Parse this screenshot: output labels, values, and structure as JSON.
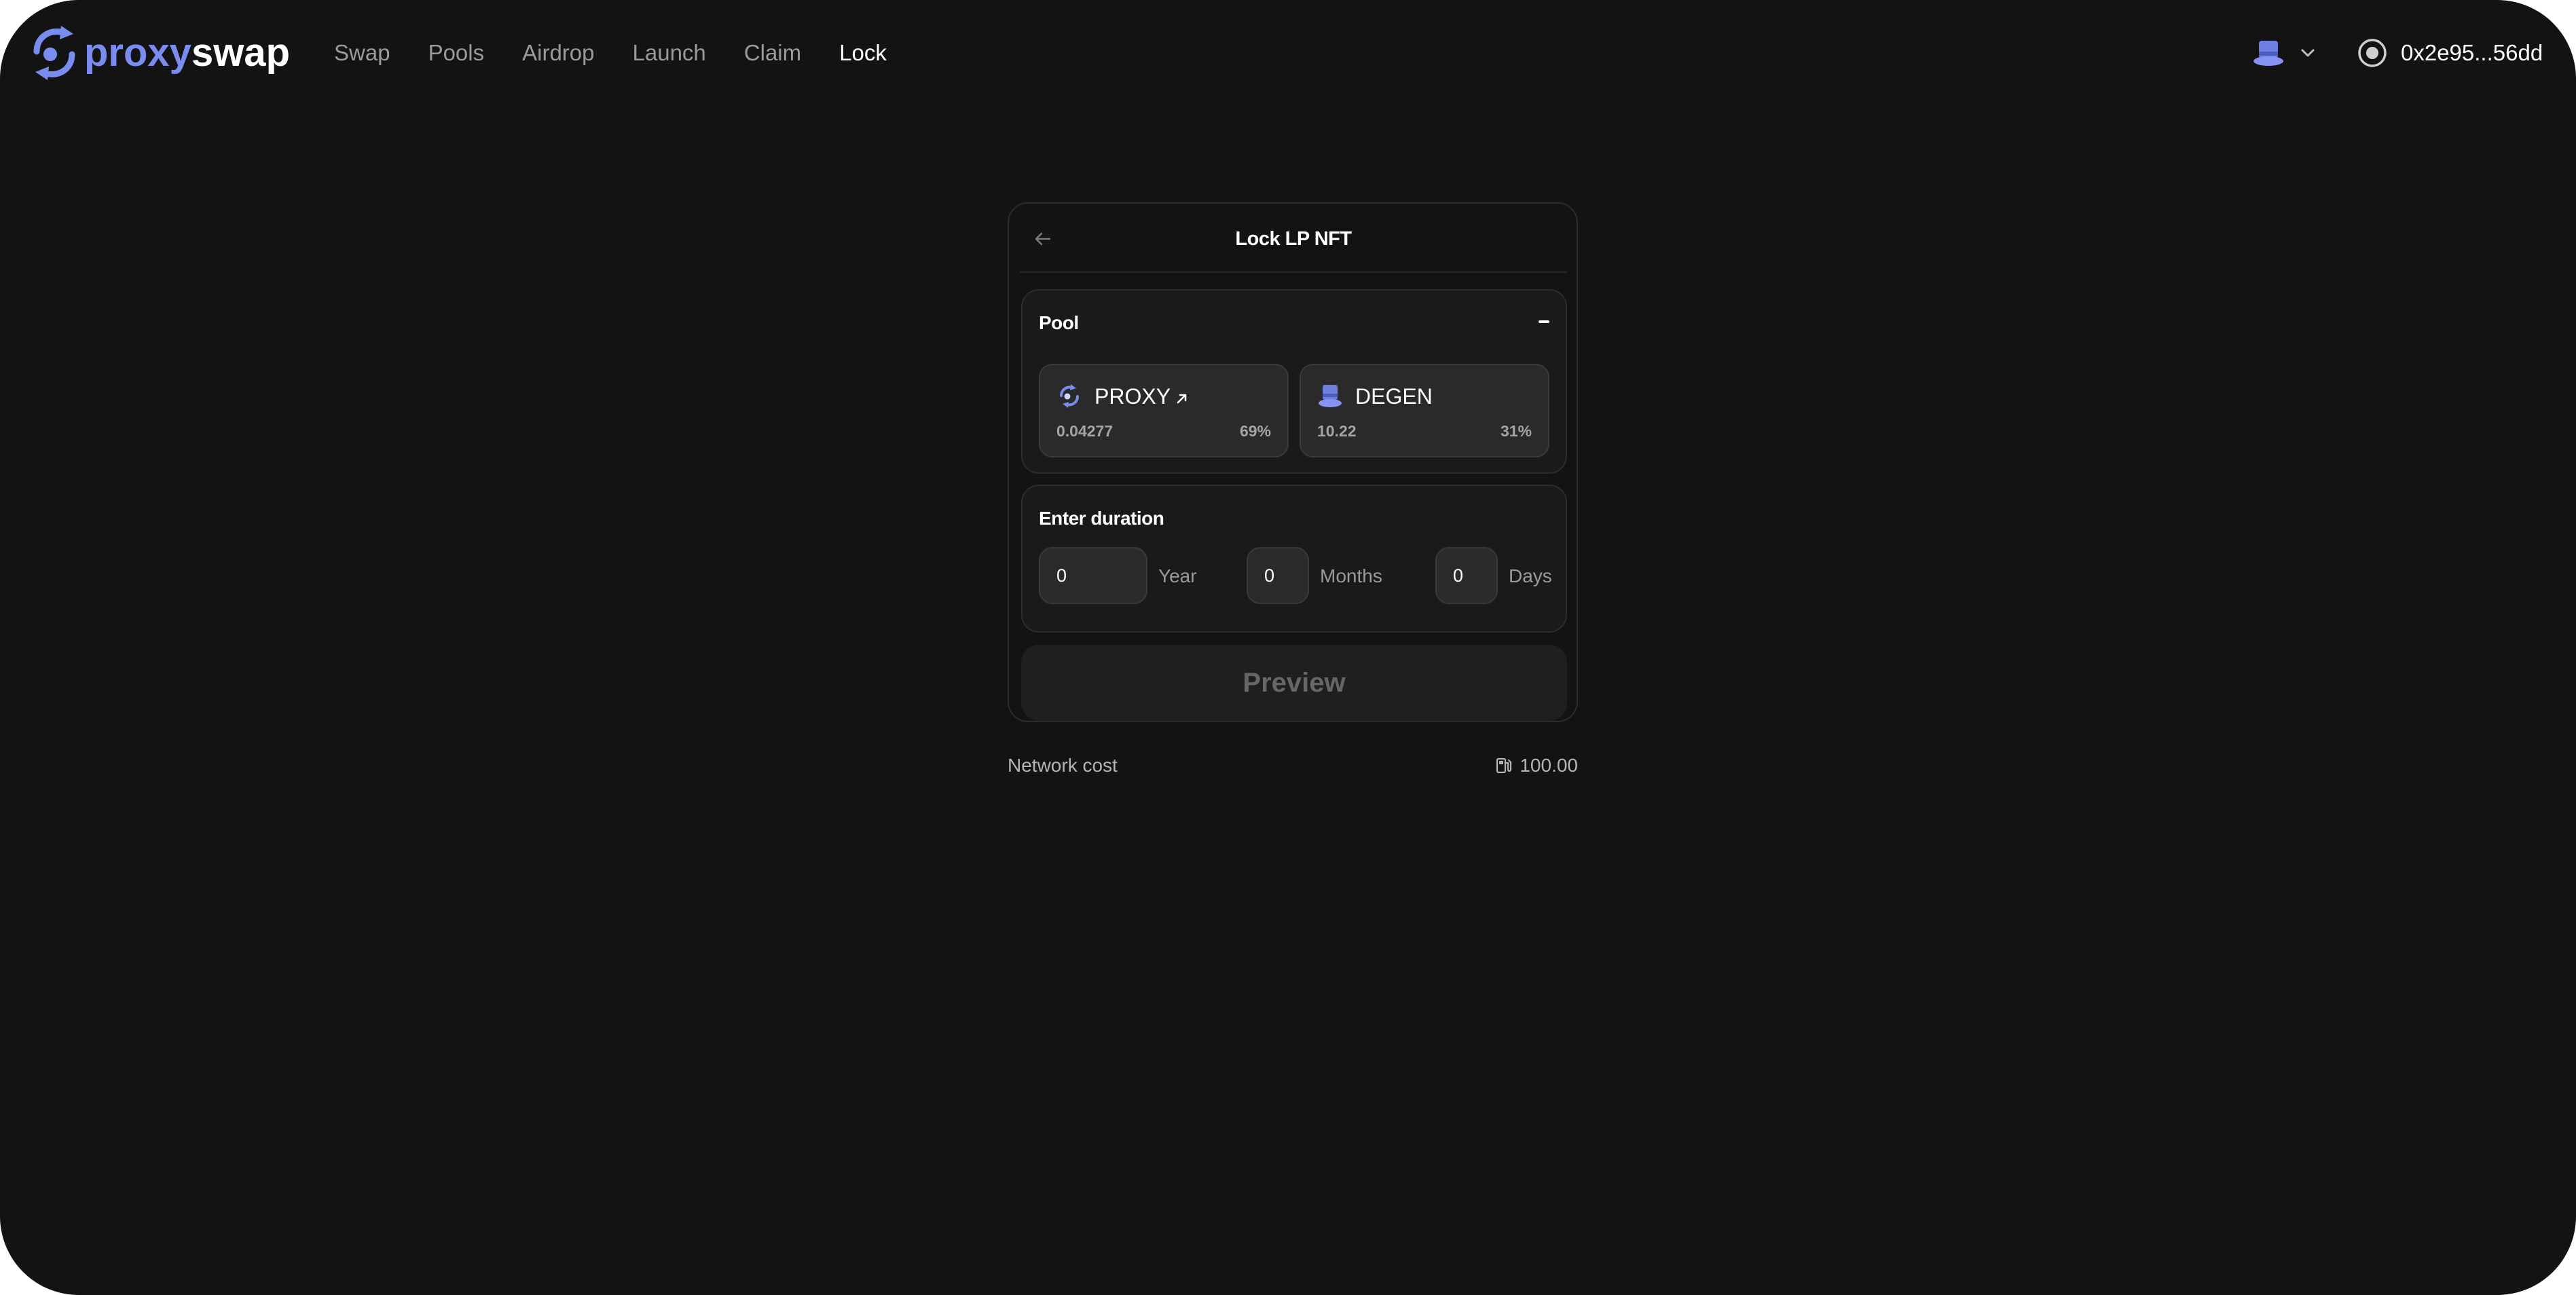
{
  "brand": {
    "name_part1": "proxy",
    "name_part2": "swap",
    "accent_color": "#7b8cf0"
  },
  "nav": {
    "items": [
      {
        "label": "Swap",
        "active": false
      },
      {
        "label": "Pools",
        "active": false
      },
      {
        "label": "Airdrop",
        "active": false
      },
      {
        "label": "Launch",
        "active": false
      },
      {
        "label": "Claim",
        "active": false
      },
      {
        "label": "Lock",
        "active": true
      }
    ]
  },
  "chain_selector": {
    "icon": "top-hat-icon"
  },
  "wallet": {
    "address": "0x2e95...56dd",
    "icon": "wallet-icon"
  },
  "card": {
    "title": "Lock LP NFT",
    "pool": {
      "label": "Pool",
      "token_a": {
        "symbol": "PROXY",
        "amount": "0.04277",
        "share": "69%",
        "icon": "proxy-logo-icon"
      },
      "token_b": {
        "symbol": "DEGEN",
        "amount": "10.22",
        "share": "31%",
        "icon": "top-hat-icon"
      }
    },
    "duration": {
      "label": "Enter duration",
      "year_value": "0",
      "year_unit": "Year",
      "months_value": "0",
      "months_unit": "Months",
      "days_value": "0",
      "days_unit": "Days"
    },
    "preview_label": "Preview"
  },
  "network": {
    "label": "Network cost",
    "value": "100.00",
    "icon": "gas-pump-icon"
  }
}
